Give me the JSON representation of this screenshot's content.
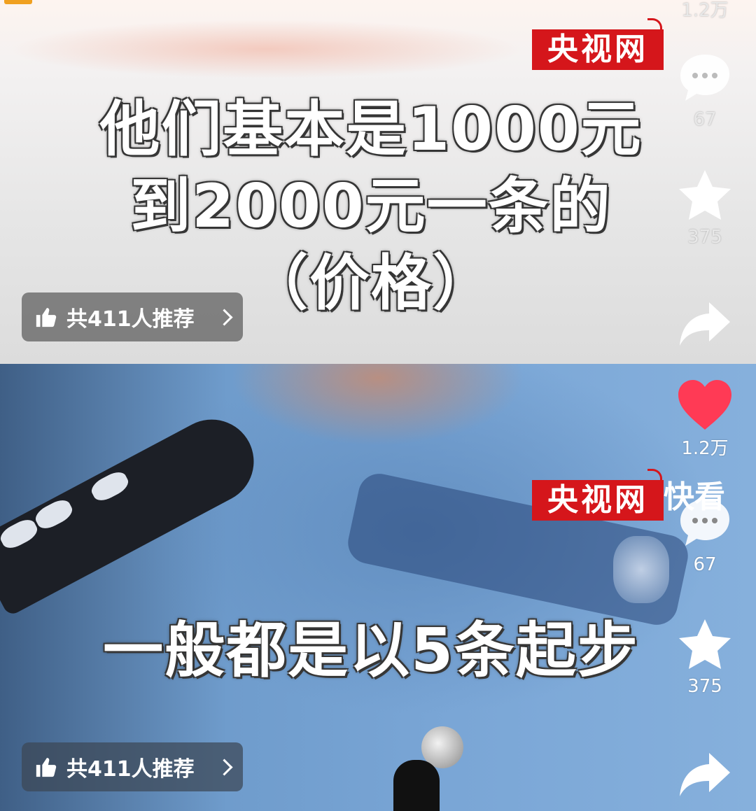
{
  "frame1": {
    "subtitle_line1": "他们基本是1000元",
    "subtitle_line2": "到2000元一条的",
    "subtitle_line3": "（价格）",
    "logo": "央视网",
    "recommend": "共411人推荐",
    "likes_top": "1.2万",
    "comments": "67",
    "favorites": "375"
  },
  "frame2": {
    "subtitle": "一般都是以5条起步",
    "logo": "央视网",
    "watermark": "快看",
    "likes": "1.2万",
    "comments": "67",
    "favorites": "375",
    "recommend": "共411人推荐"
  },
  "colors": {
    "like_red": "#ff3a55",
    "logo_red": "#d5161b",
    "pill_bg": "#5a5a5a"
  },
  "icons": [
    "thumbs-up-icon",
    "chevron-right-icon",
    "comment-icon",
    "star-icon",
    "share-icon",
    "heart-icon"
  ]
}
